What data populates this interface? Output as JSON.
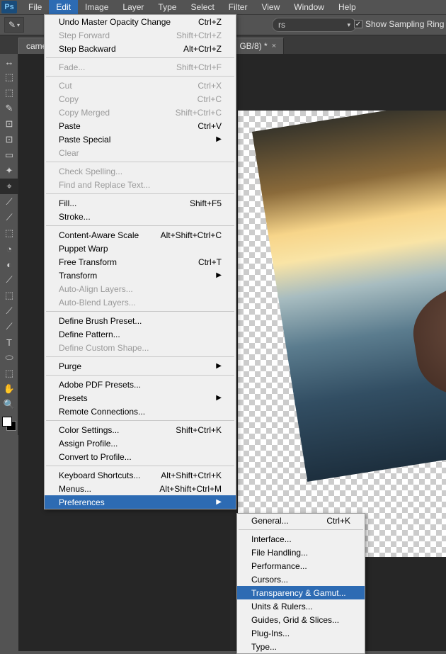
{
  "menubar": {
    "items": [
      "File",
      "Edit",
      "Image",
      "Layer",
      "Type",
      "Select",
      "Filter",
      "View",
      "Window",
      "Help"
    ],
    "open_index": 1
  },
  "optionsbar": {
    "select_tail": "rs",
    "checkbox_checked": true,
    "checkbox_label": "Show Sampling Ring"
  },
  "tabs": [
    {
      "label_head": "came"
    },
    {
      "label_tail": "GB/8) *"
    }
  ],
  "edit_menu": [
    {
      "label": "Undo Master Opacity Change",
      "shortcut": "Ctrl+Z"
    },
    {
      "label": "Step Forward",
      "shortcut": "Shift+Ctrl+Z",
      "disabled": true
    },
    {
      "label": "Step Backward",
      "shortcut": "Alt+Ctrl+Z"
    },
    {
      "sep": true
    },
    {
      "label": "Fade...",
      "shortcut": "Shift+Ctrl+F",
      "disabled": true
    },
    {
      "sep": true
    },
    {
      "label": "Cut",
      "shortcut": "Ctrl+X",
      "disabled": true
    },
    {
      "label": "Copy",
      "shortcut": "Ctrl+C",
      "disabled": true
    },
    {
      "label": "Copy Merged",
      "shortcut": "Shift+Ctrl+C",
      "disabled": true
    },
    {
      "label": "Paste",
      "shortcut": "Ctrl+V"
    },
    {
      "label": "Paste Special",
      "submenu": true
    },
    {
      "label": "Clear",
      "disabled": true
    },
    {
      "sep": true
    },
    {
      "label": "Check Spelling...",
      "disabled": true
    },
    {
      "label": "Find and Replace Text...",
      "disabled": true
    },
    {
      "sep": true
    },
    {
      "label": "Fill...",
      "shortcut": "Shift+F5"
    },
    {
      "label": "Stroke..."
    },
    {
      "sep": true
    },
    {
      "label": "Content-Aware Scale",
      "shortcut": "Alt+Shift+Ctrl+C"
    },
    {
      "label": "Puppet Warp"
    },
    {
      "label": "Free Transform",
      "shortcut": "Ctrl+T"
    },
    {
      "label": "Transform",
      "submenu": true
    },
    {
      "label": "Auto-Align Layers...",
      "disabled": true
    },
    {
      "label": "Auto-Blend Layers...",
      "disabled": true
    },
    {
      "sep": true
    },
    {
      "label": "Define Brush Preset..."
    },
    {
      "label": "Define Pattern..."
    },
    {
      "label": "Define Custom Shape...",
      "disabled": true
    },
    {
      "sep": true
    },
    {
      "label": "Purge",
      "submenu": true
    },
    {
      "sep": true
    },
    {
      "label": "Adobe PDF Presets..."
    },
    {
      "label": "Presets",
      "submenu": true
    },
    {
      "label": "Remote Connections..."
    },
    {
      "sep": true
    },
    {
      "label": "Color Settings...",
      "shortcut": "Shift+Ctrl+K"
    },
    {
      "label": "Assign Profile..."
    },
    {
      "label": "Convert to Profile..."
    },
    {
      "sep": true
    },
    {
      "label": "Keyboard Shortcuts...",
      "shortcut": "Alt+Shift+Ctrl+K"
    },
    {
      "label": "Menus...",
      "shortcut": "Alt+Shift+Ctrl+M"
    },
    {
      "label": "Preferences",
      "submenu": true,
      "hover": true
    }
  ],
  "prefs_menu": [
    {
      "label": "General...",
      "shortcut": "Ctrl+K"
    },
    {
      "sep": true
    },
    {
      "label": "Interface..."
    },
    {
      "label": "File Handling..."
    },
    {
      "label": "Performance..."
    },
    {
      "label": "Cursors..."
    },
    {
      "label": "Transparency & Gamut...",
      "hover": true
    },
    {
      "label": "Units & Rulers..."
    },
    {
      "label": "Guides, Grid & Slices..."
    },
    {
      "label": "Plug-Ins..."
    },
    {
      "label": "Type..."
    }
  ],
  "tool_icons": [
    "↔",
    "⬚",
    "⬚",
    "✎",
    "⊡",
    "⊡",
    "▭",
    "✦",
    "⌖",
    "⟋",
    "⟋",
    "⬚",
    "◔",
    "◐",
    "⟋",
    "⬚",
    "⟋",
    "⟋",
    "T",
    "⬭",
    "⬚",
    "✋",
    "🔍"
  ]
}
